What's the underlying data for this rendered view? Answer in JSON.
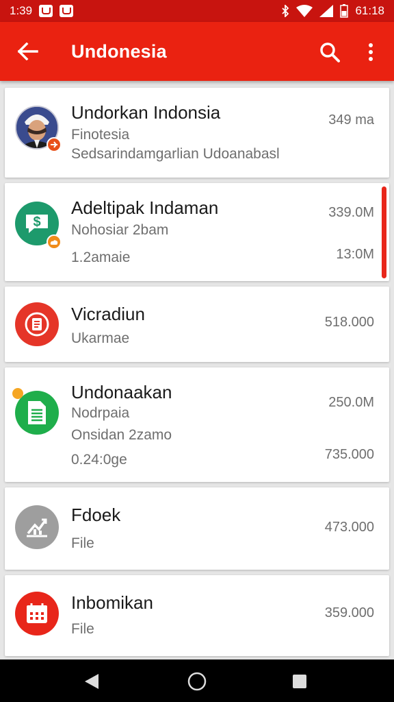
{
  "status_bar": {
    "time": "1:39",
    "clock_right": "61:18",
    "icons": [
      "notification-icon",
      "notification-icon",
      "bluetooth-icon",
      "wifi-icon",
      "signal-icon",
      "battery-icon"
    ]
  },
  "app_bar": {
    "title": "Undonesia",
    "icons": [
      "back-arrow-icon",
      "search-icon",
      "more-vert-icon"
    ]
  },
  "list": [
    {
      "title": "Undorkan Indonsia",
      "line1": "Finotesia",
      "line2": "Sedsarindamgarlian Udoanabasl",
      "meta": "349 ma",
      "icon": "person-photo-avatar",
      "badge_icon": "plane-icon",
      "badge_color": "#e8501a"
    },
    {
      "title": "Adeltipak Indaman",
      "line1": "Nohosiar 2bam",
      "line2": "1.2amaie",
      "meta": "339.0M",
      "meta2": "13:0M",
      "icon": "dollar-chat-icon",
      "icon_color": "#1d9a6c",
      "badge_icon": "cloud-icon",
      "badge_color": "#f08c1a"
    },
    {
      "title": "Vicradiun",
      "line1": "Ukarmae",
      "meta": "518.000",
      "icon": "document-list-icon",
      "icon_color": "#e53528"
    },
    {
      "title": "Undonaakan",
      "line1": "Nodrpaia",
      "line2": "Onsidan 2zamo",
      "line3": "0.24:0ge",
      "meta": "250.0M",
      "meta2": "735.000",
      "icon": "spreadsheet-icon",
      "icon_color": "#1fae4b",
      "badge_color": "#f5a623"
    },
    {
      "title": "Fdoek",
      "line1": "File",
      "meta": "473.000",
      "icon": "chart-icon",
      "icon_color": "#9e9e9e"
    },
    {
      "title": "Inbomikan",
      "line1": "File",
      "meta": "359.000",
      "icon": "calendar-icon",
      "icon_color": "#e8261a"
    }
  ],
  "nav_bar": {
    "icons": [
      "back-triangle-icon",
      "home-circle-icon",
      "recents-square-icon"
    ]
  },
  "colors": {
    "status_bar": "#c8140f",
    "app_bar": "#ea2211",
    "accent": "#e8261a"
  }
}
